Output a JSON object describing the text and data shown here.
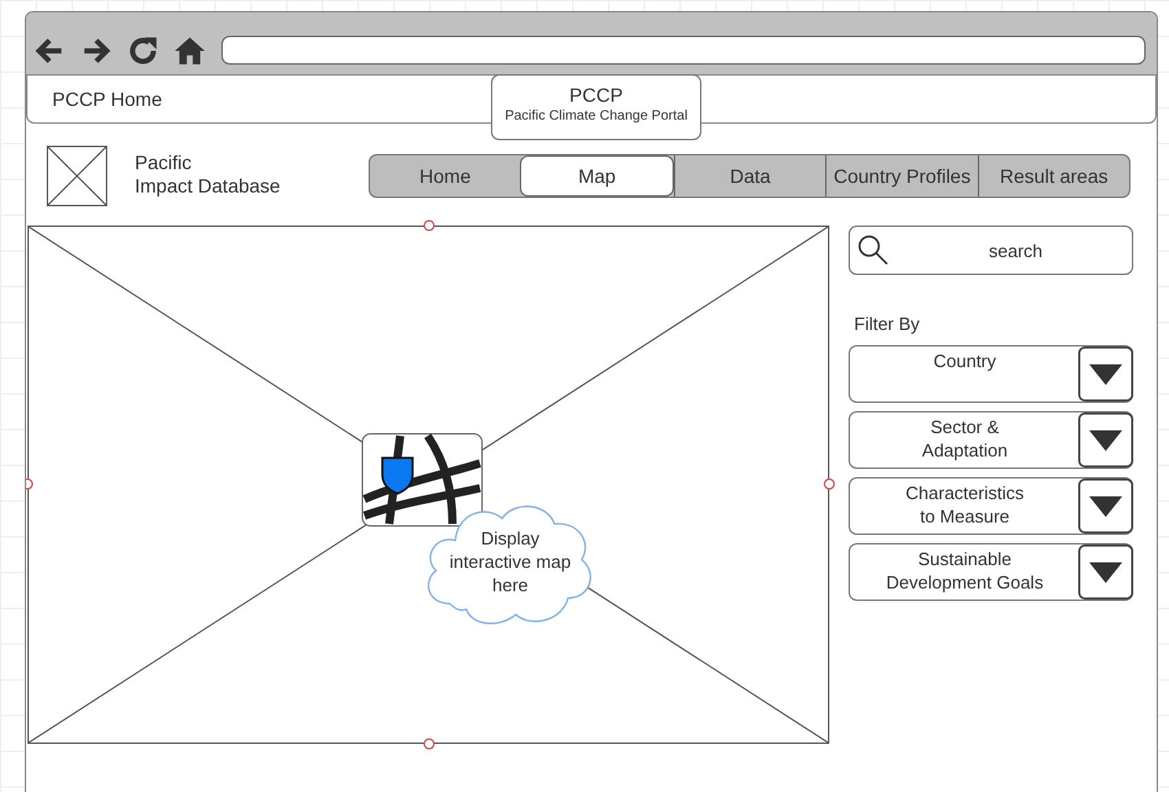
{
  "browser": {
    "tab": {
      "label": "PCCP Home"
    }
  },
  "site_tab": {
    "title": "PCCP",
    "subtitle": "Pacific Climate Change Portal"
  },
  "site_title": "Pacific\nImpact Database",
  "nav": [
    {
      "label": "Home",
      "selected": false
    },
    {
      "label": "Map",
      "selected": true
    },
    {
      "label": "Data",
      "selected": false
    },
    {
      "label": "Country Profiles",
      "selected": false
    },
    {
      "label": "Result areas",
      "selected": false
    }
  ],
  "map": {
    "note": "Display interactive map\nhere"
  },
  "search": {
    "placeholder": "search"
  },
  "filter_label": "Filter By",
  "filters": [
    {
      "label": "Country"
    },
    {
      "label": "Sector &\nAdaptation"
    },
    {
      "label": "Characteristics\nto Measure"
    },
    {
      "label": "Sustainable\nDevelopment Goals"
    }
  ]
}
